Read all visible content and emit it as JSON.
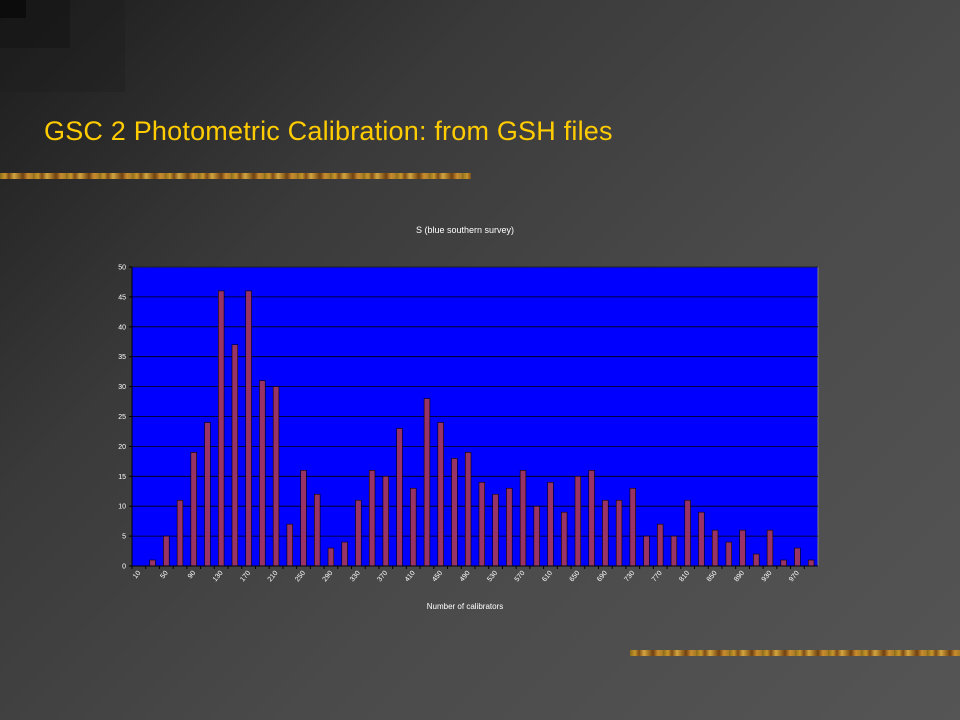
{
  "slide": {
    "title": "GSC 2 Photometric Calibration: from GSH files"
  },
  "colors": {
    "title": "#ffcc00",
    "plot_background": "#0000ff",
    "bar_fill": "#993366",
    "chart_text": "#ffffff",
    "gridline": "#000000"
  },
  "chart_data": {
    "type": "bar",
    "title": "S (blue southern survey)",
    "xlabel": "Number of calibrators",
    "ylabel": "",
    "ylim": [
      0,
      50
    ],
    "yticks": [
      0,
      5,
      10,
      15,
      20,
      25,
      30,
      35,
      40,
      45,
      50
    ],
    "grid": true,
    "legend": "none",
    "categories": [
      10,
      30,
      50,
      70,
      90,
      110,
      130,
      150,
      170,
      190,
      210,
      230,
      250,
      270,
      290,
      310,
      330,
      350,
      370,
      390,
      410,
      430,
      450,
      470,
      490,
      510,
      530,
      550,
      570,
      590,
      610,
      630,
      650,
      670,
      690,
      710,
      730,
      750,
      770,
      790,
      810,
      830,
      850,
      870,
      890,
      910,
      930,
      950,
      970,
      990
    ],
    "tick_labels": [
      "10",
      "50",
      "90",
      "130",
      "170",
      "210",
      "250",
      "290",
      "330",
      "370",
      "410",
      "450",
      "490",
      "530",
      "570",
      "610",
      "650",
      "690",
      "730",
      "770",
      "810",
      "850",
      "890",
      "930",
      "970"
    ],
    "values": [
      0,
      1,
      5,
      11,
      19,
      24,
      46,
      37,
      46,
      31,
      30,
      7,
      16,
      12,
      3,
      4,
      11,
      16,
      15,
      23,
      13,
      28,
      24,
      18,
      19,
      14,
      12,
      13,
      16,
      10,
      14,
      9,
      15,
      16,
      11,
      11,
      13,
      5,
      7,
      5,
      11,
      9,
      6,
      4,
      6,
      2,
      6,
      1,
      3,
      1
    ]
  }
}
